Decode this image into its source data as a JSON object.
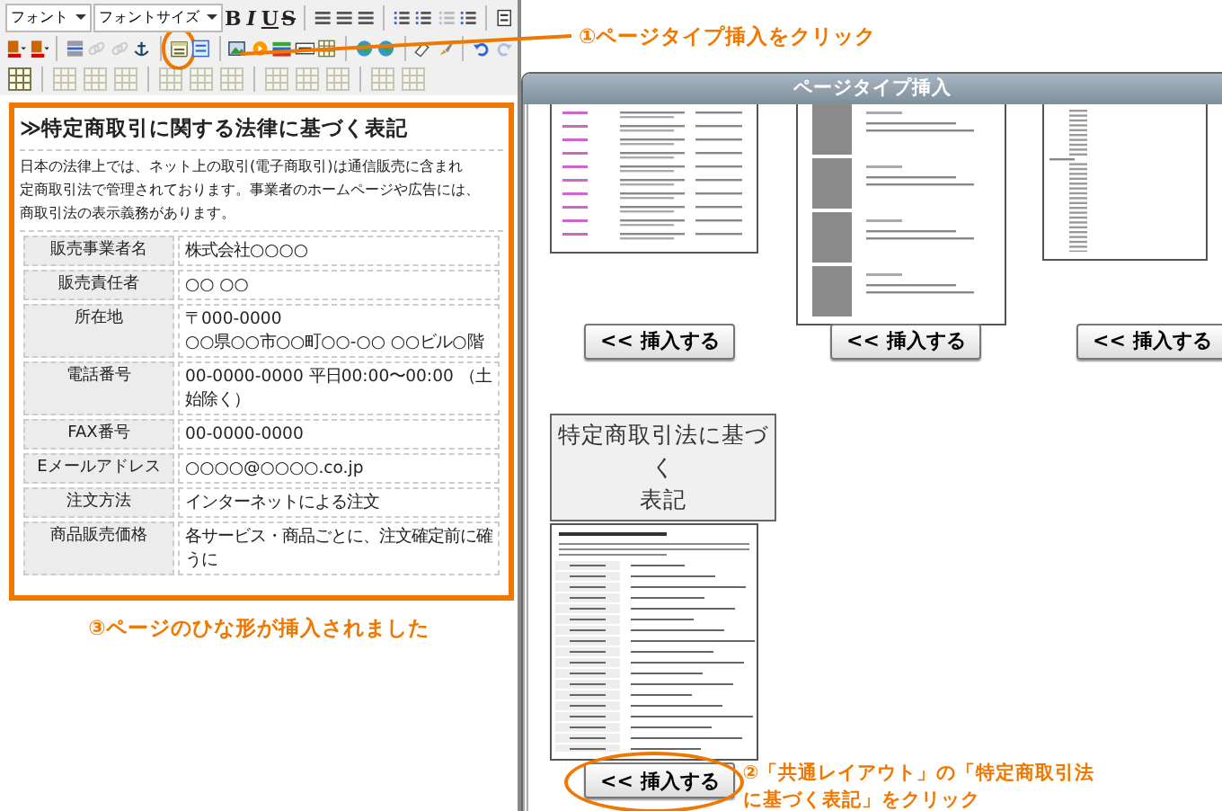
{
  "toolbar": {
    "rows": [
      [
        {
          "kind": "dropdown",
          "label": "フォント"
        },
        {
          "kind": "dropdown",
          "label": "フォントサイズ"
        },
        {
          "kind": "bold",
          "label": "B"
        },
        {
          "kind": "italic",
          "label": "I"
        },
        {
          "kind": "underline",
          "label": "U"
        },
        {
          "kind": "strike",
          "label": "S"
        },
        {
          "kind": "sep"
        },
        {
          "kind": "lines"
        },
        {
          "kind": "lines"
        },
        {
          "kind": "lines"
        },
        {
          "kind": "sep"
        },
        {
          "kind": "list"
        },
        {
          "kind": "list"
        },
        {
          "kind": "list",
          "disabled": true
        },
        {
          "kind": "list"
        },
        {
          "kind": "sep"
        },
        {
          "kind": "page"
        }
      ],
      [
        {
          "kind": "color"
        },
        {
          "kind": "color"
        },
        {
          "kind": "sep"
        },
        {
          "kind": "rule"
        },
        {
          "kind": "chain",
          "disabled": true
        },
        {
          "kind": "chain",
          "disabled": true
        },
        {
          "kind": "anchor"
        },
        {
          "kind": "sep"
        },
        {
          "kind": "pagetype",
          "highlighted": true
        },
        {
          "kind": "template"
        },
        {
          "kind": "sep"
        },
        {
          "kind": "picture"
        },
        {
          "kind": "media"
        },
        {
          "kind": "bars"
        },
        {
          "kind": "box"
        },
        {
          "kind": "table"
        },
        {
          "kind": "sep"
        },
        {
          "kind": "globe"
        },
        {
          "kind": "globe"
        },
        {
          "kind": "sep"
        },
        {
          "kind": "eraser"
        },
        {
          "kind": "brush"
        },
        {
          "kind": "sep"
        },
        {
          "kind": "undo"
        },
        {
          "kind": "redo",
          "disabled": true
        }
      ],
      [
        {
          "kind": "table"
        },
        {
          "kind": "sep"
        },
        {
          "kind": "table",
          "disabled": true
        },
        {
          "kind": "table",
          "disabled": true
        },
        {
          "kind": "table",
          "disabled": true
        },
        {
          "kind": "sep"
        },
        {
          "kind": "table",
          "disabled": true
        },
        {
          "kind": "table",
          "disabled": true
        },
        {
          "kind": "table",
          "disabled": true
        },
        {
          "kind": "sep"
        },
        {
          "kind": "table",
          "disabled": true
        },
        {
          "kind": "table",
          "disabled": true
        },
        {
          "kind": "table",
          "disabled": true
        },
        {
          "kind": "sep"
        },
        {
          "kind": "table",
          "disabled": true
        },
        {
          "kind": "table",
          "disabled": true
        }
      ]
    ]
  },
  "editor": {
    "heading": "≫特定商取引に関する法律に基づく表記",
    "paragraph_lines": [
      "日本の法律上では、ネット上の取引(電子商取引)は通信販売に含まれ",
      "定商取引法で管理されております。事業者のホームページや広告には、",
      "商取引法の表示義務があります。"
    ],
    "rows": [
      {
        "label": "販売事業者名",
        "lines": [
          "株式会社○○○○"
        ]
      },
      {
        "label": "販売責任者",
        "lines": [
          "○○  ○○"
        ]
      },
      {
        "label": "所在地",
        "lines": [
          "〒000-0000",
          "○○県○○市○○町○○-○○  ○○ビル○階"
        ]
      },
      {
        "label": "電話番号",
        "lines": [
          "00-0000-0000  平日00:00〜00:00 （土",
          "始除く）"
        ]
      },
      {
        "label": "FAX番号",
        "lines": [
          "00-0000-0000"
        ]
      },
      {
        "label": "Eメールアドレス",
        "lines": [
          "○○○○@○○○○.co.jp"
        ]
      },
      {
        "label": "注文方法",
        "lines": [
          "インターネットによる注文"
        ]
      },
      {
        "label": "商品販売価格",
        "lines": [
          "各サービス・商品ごとに、注文確定前に確",
          "うに"
        ]
      }
    ]
  },
  "dialog": {
    "title": "ページタイプ挿入",
    "templates": [
      {
        "kind": "list",
        "button": "<< 挿入する",
        "highlighted": false
      },
      {
        "kind": "cards",
        "button": "<< 挿入する",
        "highlighted": false
      },
      {
        "kind": "outline",
        "button": "<< 挿入する",
        "highlighted": false
      },
      {
        "kind": "legal",
        "title_lines": [
          "特定商取引法に基づく",
          "表記"
        ],
        "button": "<< 挿入する",
        "highlighted": true
      }
    ]
  },
  "annotations": {
    "step1": "①ページタイプ挿入をクリック",
    "step2_lines": [
      "②「共通レイアウト」の「特定商取引法",
      "に基づく表記」をクリック"
    ],
    "step3": "③ページのひな形が挿入されました"
  }
}
